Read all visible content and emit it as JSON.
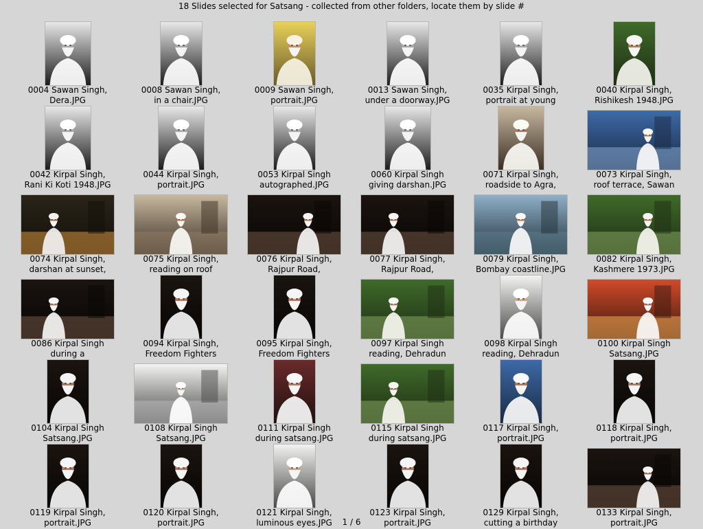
{
  "header": {
    "title": "18 Slides selected for Satsang - collected from other folders, locate them by slide #"
  },
  "pager": {
    "text": "1 / 6"
  },
  "slides": [
    {
      "line1": "0004  Sawan Singh,",
      "line2": "Dera.JPG",
      "orient": "portrait-w",
      "tone": "bw"
    },
    {
      "line1": "0008  Sawan Singh,",
      "line2": "in a chair.JPG",
      "orient": "portrait",
      "tone": "bw"
    },
    {
      "line1": "0009  Sawan Singh,",
      "line2": "portrait.JPG",
      "orient": "portrait",
      "tone": "yellow"
    },
    {
      "line1": "0013  Sawan Singh,",
      "line2": "under a doorway.JPG",
      "orient": "portrait",
      "tone": "bw"
    },
    {
      "line1": "0035  Kirpal Singh,",
      "line2": "portrait at young",
      "orient": "portrait",
      "tone": "bw"
    },
    {
      "line1": "0040  Kirpal Singh,",
      "line2": "Rishikesh 1948.JPG",
      "orient": "portrait",
      "tone": "green"
    },
    {
      "line1": "0042  Kirpal Singh,",
      "line2": "Rani Ki Koti 1948.JPG",
      "orient": "portrait-w",
      "tone": "bw"
    },
    {
      "line1": "0044  Kirpal Singh,",
      "line2": "portrait.JPG",
      "orient": "landscape-p",
      "tone": "bw"
    },
    {
      "line1": "0053  Kirpal Singh",
      "line2": "autographed.JPG",
      "orient": "portrait",
      "tone": "bw"
    },
    {
      "line1": "0060  Kirpal Singh",
      "line2": "giving darshan.JPG",
      "orient": "portrait-w",
      "tone": "bw"
    },
    {
      "line1": "0071  Kirpal Singh,",
      "line2": "roadside to Agra,",
      "orient": "portrait-w",
      "tone": "color"
    },
    {
      "line1": "0073  Kirpal Singh,",
      "line2": "roof terrace, Sawan",
      "orient": "landscape",
      "tone": "blue"
    },
    {
      "line1": "0074  Kirpal Singh,",
      "line2": "darshan at sunset,",
      "orient": "landscape",
      "tone": "sunset"
    },
    {
      "line1": "0075  Kirpal Singh,",
      "line2": "reading on roof",
      "orient": "landscape",
      "tone": "color"
    },
    {
      "line1": "0076  Kirpal Singh,",
      "line2": "Rajpur Road,",
      "orient": "landscape",
      "tone": "dark"
    },
    {
      "line1": "0077  Kirpal Singh,",
      "line2": "Rajpur Road,",
      "orient": "landscape",
      "tone": "dark"
    },
    {
      "line1": "0079  Kirpal Singh,",
      "line2": "Bombay coastline.JPG",
      "orient": "landscape",
      "tone": "sky"
    },
    {
      "line1": "0082  Kirpal Singh,",
      "line2": "Kashmere 1973.JPG",
      "orient": "landscape",
      "tone": "green"
    },
    {
      "line1": "0086  Kirpal Singh",
      "line2": "during a",
      "orient": "landscape",
      "tone": "dark"
    },
    {
      "line1": "0094  Kirpal Singh,",
      "line2": "Freedom Fighters",
      "orient": "portrait",
      "tone": "dark"
    },
    {
      "line1": "0095  Kirpal Singh,",
      "line2": "Freedom Fighters",
      "orient": "portrait",
      "tone": "dark"
    },
    {
      "line1": "0097  Kirpal Singh",
      "line2": "reading, Dehradun",
      "orient": "landscape",
      "tone": "green"
    },
    {
      "line1": "0098  Kirpal Singh",
      "line2": "reading, Dehradun",
      "orient": "portrait",
      "tone": "light"
    },
    {
      "line1": "0100  Kirpal Singh",
      "line2": "Satsang.JPG",
      "orient": "landscape",
      "tone": "red"
    },
    {
      "line1": "0104  Kirpal Singh",
      "line2": "Satsang.JPG",
      "orient": "portrait",
      "tone": "dark"
    },
    {
      "line1": "0108  Kirpal Singh",
      "line2": "Satsang.JPG",
      "orient": "landscape",
      "tone": "light"
    },
    {
      "line1": "0111  Kirpal Singh",
      "line2": "during satsang.JPG",
      "orient": "portrait",
      "tone": "pink"
    },
    {
      "line1": "0115  Kirpal Singh",
      "line2": "during satsang.JPG",
      "orient": "landscape",
      "tone": "green"
    },
    {
      "line1": "0117  Kirpal Singh,",
      "line2": "portrait.JPG",
      "orient": "portrait",
      "tone": "blue"
    },
    {
      "line1": "0118  Kirpal Singh,",
      "line2": "portrait.JPG",
      "orient": "portrait",
      "tone": "dark"
    },
    {
      "line1": "0119  Kirpal Singh,",
      "line2": "portrait.JPG",
      "orient": "portrait",
      "tone": "dark"
    },
    {
      "line1": "0120  Kirpal Singh,",
      "line2": "portrait.JPG",
      "orient": "portrait",
      "tone": "dark"
    },
    {
      "line1": "0121  Kirpal Singh,",
      "line2": "luminous eyes.JPG",
      "orient": "portrait",
      "tone": "light"
    },
    {
      "line1": "0123  Kirpal Singh,",
      "line2": "portrait.JPG",
      "orient": "portrait",
      "tone": "dark"
    },
    {
      "line1": "0129  Kirpal Singh,",
      "line2": "cutting a birthday",
      "orient": "portrait",
      "tone": "dark"
    },
    {
      "line1": "0133  Kirpal Singh,",
      "line2": "portrait.JPG",
      "orient": "landscape",
      "tone": "dark"
    }
  ],
  "tones": {
    "bw": {
      "bg": "#e8e8e8",
      "mid": "#7a7a7a",
      "dark": "#1c1c1c",
      "turban": "#ffffff",
      "face": "#a9a9a9"
    },
    "yellow": {
      "bg": "#e8d15a",
      "mid": "#c9a94a",
      "dark": "#6b5a2a",
      "turban": "#f7f3e4",
      "face": "#c98e6a"
    },
    "green": {
      "bg": "#3f6a2a",
      "mid": "#7f9c5a",
      "dark": "#1e2e14",
      "turban": "#f6f6f0",
      "face": "#b5805e"
    },
    "color": {
      "bg": "#c7b8a0",
      "mid": "#8e7b64",
      "dark": "#3b2f24",
      "turban": "#fbfbf6",
      "face": "#b07a5a"
    },
    "blue": {
      "bg": "#3d6aa6",
      "mid": "#7fa0c8",
      "dark": "#1a2a44",
      "turban": "#fafafa",
      "face": "#b07a5a"
    },
    "sunset": {
      "bg": "#2a2418",
      "mid": "#c68a3a",
      "dark": "#120f0a",
      "turban": "#f2f2f2",
      "face": "#9a6a4a"
    },
    "dark": {
      "bg": "#1b1410",
      "mid": "#6a5040",
      "dark": "#070504",
      "turban": "#f5f5f5",
      "face": "#b0785a"
    },
    "sky": {
      "bg": "#8fb0c8",
      "mid": "#5a7a8a",
      "dark": "#23313a",
      "turban": "#fafafa",
      "face": "#b07a5a"
    },
    "light": {
      "bg": "#f2f2f0",
      "mid": "#b8b8b8",
      "dark": "#4a4a4a",
      "turban": "#ffffff",
      "face": "#c9a58a"
    },
    "red": {
      "bg": "#d24a2a",
      "mid": "#e8a050",
      "dark": "#3a1a10",
      "turban": "#fafafa",
      "face": "#b07a5a"
    },
    "pink": {
      "bg": "#6a2a2a",
      "mid": "#d880a0",
      "dark": "#201010",
      "turban": "#f8f8f8",
      "face": "#b07a5a"
    }
  }
}
